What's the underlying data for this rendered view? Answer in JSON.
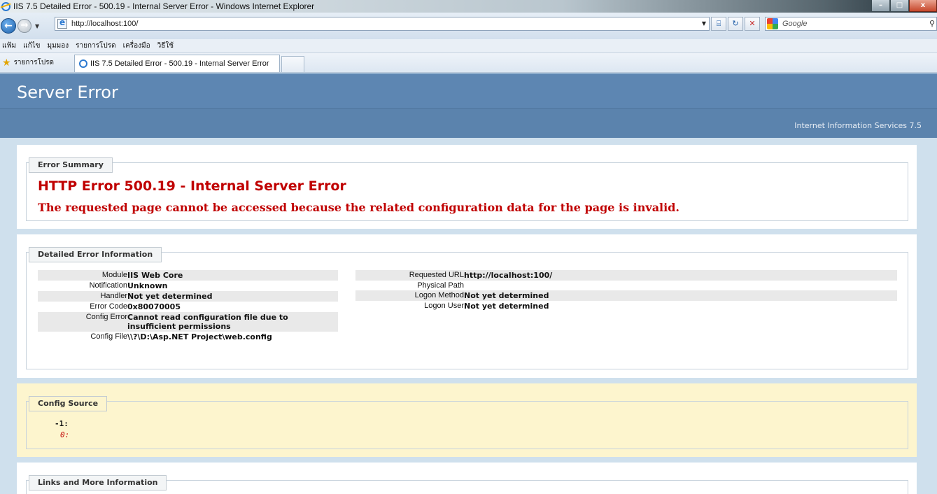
{
  "window": {
    "title": "IIS 7.5 Detailed Error - 500.19 - Internal Server Error - Windows Internet Explorer",
    "controls": {
      "minimize": "–",
      "maximize": "□",
      "close": "x"
    }
  },
  "toolbar": {
    "back_glyph": "←",
    "forward_glyph": "→",
    "dropdown_glyph": "▼",
    "url": "http://localhost:100/",
    "compat_glyph": "⌸",
    "refresh_glyph": "↻",
    "stop_glyph": "✕",
    "search_placeholder": "Google",
    "search_glyph": "⚲"
  },
  "menu": {
    "items": [
      "แฟ้ม",
      "แก้ไข",
      "มุมมอง",
      "รายการโปรด",
      "เครื่องมือ",
      "วิธีใช้"
    ]
  },
  "favorites": {
    "label": "รายการโปรด",
    "tab_title": "IIS 7.5 Detailed Error - 500.19 - Internal Server Error"
  },
  "page": {
    "header_title": "Server Error",
    "product": "Internet Information Services 7.5",
    "summary": {
      "legend": "Error Summary",
      "title": "HTTP Error 500.19 - Internal Server Error",
      "subtitle": "The requested page cannot be accessed because the related configuration data for the page is invalid."
    },
    "details": {
      "legend": "Detailed Error Information",
      "left": [
        {
          "key": "Module",
          "value": "IIS Web Core"
        },
        {
          "key": "Notification",
          "value": "Unknown"
        },
        {
          "key": "Handler",
          "value": "Not yet determined"
        },
        {
          "key": "Error Code",
          "value": "0x80070005"
        },
        {
          "key": "Config Error",
          "value": "Cannot read configuration file due to insufficient permissions"
        },
        {
          "key": "Config File",
          "value": "\\\\?\\D:\\Asp.NET Project\\web.config"
        }
      ],
      "right": [
        {
          "key": "Requested URL",
          "value": "http://localhost:100/"
        },
        {
          "key": "Physical Path",
          "value": ""
        },
        {
          "key": "Logon Method",
          "value": "Not yet determined"
        },
        {
          "key": "Logon User",
          "value": "Not yet determined"
        }
      ]
    },
    "config_source": {
      "legend": "Config Source",
      "lines": [
        "-1:",
        "0:"
      ]
    },
    "links": {
      "legend": "Links and More Information"
    }
  },
  "colors": {
    "header_blue": "#5d86b2",
    "error_red": "#c00000",
    "config_yellow": "#fdf5ce"
  }
}
